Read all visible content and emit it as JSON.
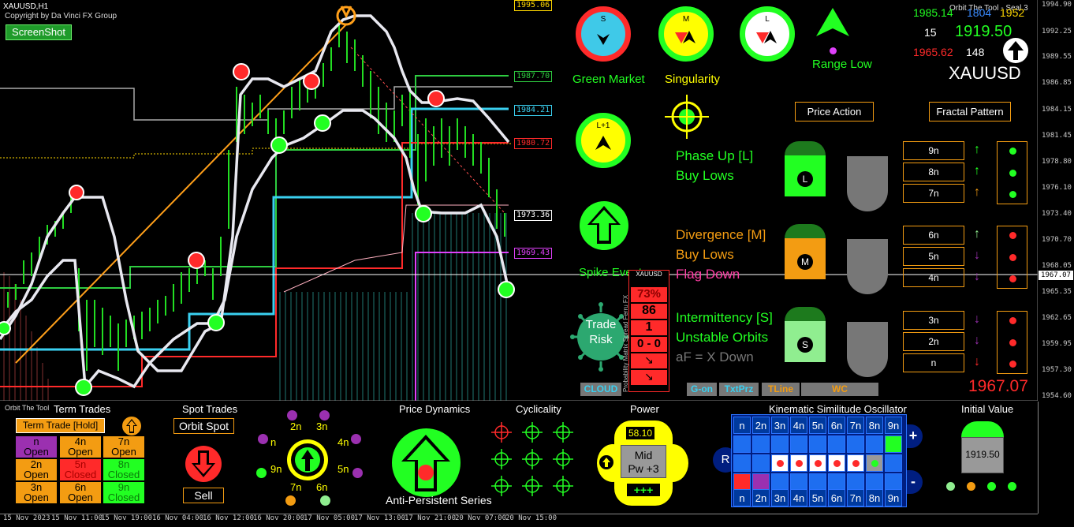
{
  "window": {
    "symbol_tf": "XAUUSD,H1",
    "copyright": "Copyright by Da Vinci FX Group",
    "orbit_tool_label": "Orbit The Tool - Seal 3"
  },
  "screenshot_button": "ScreenShot",
  "price_levels": [
    {
      "label": "1995.06",
      "color": "#ffd700"
    },
    {
      "label": "1987.70",
      "color": "#2ecc40"
    },
    {
      "label": "1984.21",
      "color": "#3ad0f0"
    },
    {
      "label": "1980.72",
      "color": "#ff2a2a"
    },
    {
      "label": "1973.36",
      "color": "#ffffff"
    },
    {
      "label": "1969.43",
      "color": "#e040fb"
    }
  ],
  "y_axis": [
    "1994.90",
    "1992.25",
    "1989.55",
    "1986.85",
    "1984.15",
    "1981.45",
    "1978.80",
    "1976.10",
    "1973.40",
    "1970.70",
    "1968.05",
    "1965.35",
    "1962.65",
    "1959.95",
    "1957.30",
    "1954.60"
  ],
  "current_price_tag": "1967.07",
  "x_axis": [
    "15 Nov 2023",
    "15 Nov 11:00",
    "15 Nov 19:00",
    "16 Nov 04:00",
    "16 Nov 12:00",
    "16 Nov 20:00",
    "17 Nov 05:00",
    "17 Nov 13:00",
    "17 Nov 21:00",
    "20 Nov 07:00",
    "20 Nov 15:00"
  ],
  "top_dials": [
    {
      "letter": "S",
      "ring": "#ff2a2a",
      "fill": "#3fc9e8",
      "caption": "Green Market",
      "caption_color": "#22ff22"
    },
    {
      "letter": "M",
      "ring": "#22ff22",
      "fill": "#ffff00",
      "caption": "Singularity",
      "caption_color": "#ffff00"
    },
    {
      "letter": "L",
      "ring": "#22ff22",
      "fill": "#ffffff",
      "caption": "",
      "caption_color": "#fff"
    }
  ],
  "range_low": "Range Low",
  "stats": {
    "v1": "1985.14",
    "v2": "1804",
    "v3": "1952",
    "count1": "15",
    "price": "1919.50",
    "low": "1965.62",
    "count2": "148",
    "symbol": "XAUUSD"
  },
  "buttons": {
    "price_action": "Price Action",
    "fractal_pattern": "Fractal Pattern"
  },
  "lplus_dial": "L+1",
  "spike_event": "Spike Event",
  "phases": [
    {
      "line1": "Phase Up [L]",
      "line2": "Buy Lows",
      "color1": "#22ff22",
      "color2": "#22ff22",
      "badge": "L",
      "badge_color": "#22ff22"
    },
    {
      "line1": "Divergence [M]",
      "line2": "Buy Lows",
      "line3": "Flag Down",
      "color1": "#f39c12",
      "color2": "#f39c12",
      "badge": "M",
      "badge_color": "#f39c12"
    },
    {
      "line1": "Intermittency [S]",
      "line2": "Unstable Orbits",
      "line3": "aF = X Down",
      "color1": "#22ff22",
      "color2": "#22ff22",
      "badge": "S",
      "badge_color": "#90ee90"
    }
  ],
  "n_rows": [
    {
      "label": "9n",
      "arrow": "up",
      "color": "#22ff22",
      "dot": "#22ff22"
    },
    {
      "label": "8n",
      "arrow": "up",
      "color": "#22ff22",
      "dot": "#22ff22"
    },
    {
      "label": "7n",
      "arrow": "up",
      "color": "#f39c12",
      "dot": "#22ff22"
    },
    {
      "label": "6n",
      "arrow": "up",
      "color": "#90ee90",
      "dot": "#ff2a2a"
    },
    {
      "label": "5n",
      "arrow": "down",
      "color": "#9b30b0",
      "dot": "#ff2a2a"
    },
    {
      "label": "4n",
      "arrow": "down",
      "color": "#9b30b0",
      "dot": "#ff2a2a"
    },
    {
      "label": "3n",
      "arrow": "down",
      "color": "#9b30b0",
      "dot": "#ff2a2a"
    },
    {
      "label": "2n",
      "arrow": "down",
      "color": "#9b30b0",
      "dot": "#ff2a2a"
    },
    {
      "label": "n",
      "arrow": "down",
      "color": "#ff2a2a",
      "dot": "#ff2a2a"
    }
  ],
  "trade_risk": "Trade Risk",
  "risk_column": {
    "header": "XAUUSD",
    "pct": "73%",
    "v1": "86",
    "v2": "1",
    "v3": "0 - 0",
    "side_text": "Probability Matrix Spread Ferru FX"
  },
  "bottom_tags": [
    "CLOUD",
    "G-on",
    "TxtPrz",
    "TLine",
    "WC"
  ],
  "big_price": "1967.07",
  "term_trades": {
    "title": "Term Trades",
    "orbit_label": "Orbit The Tool",
    "hold_button": "Term Trade [Hold]",
    "cells": [
      {
        "text": "n\nOpen",
        "bg": "#9b30b0",
        "color": "#000"
      },
      {
        "text": "4n\nOpen",
        "bg": "#f39c12",
        "color": "#000"
      },
      {
        "text": "7n\nOpen",
        "bg": "#f39c12",
        "color": "#000"
      },
      {
        "text": "2n\nOpen",
        "bg": "#f39c12",
        "color": "#000"
      },
      {
        "text": "5n\nClosed",
        "bg": "#ff2a2a",
        "color": "#c00"
      },
      {
        "text": "8n\nClosed",
        "bg": "#22ff22",
        "color": "#0a7a0a"
      },
      {
        "text": "3n\nOpen",
        "bg": "#f39c12",
        "color": "#000"
      },
      {
        "text": "6n\nOpen",
        "bg": "#f39c12",
        "color": "#000"
      },
      {
        "text": "9n\nClosed",
        "bg": "#22ff22",
        "color": "#0a7a0a"
      }
    ]
  },
  "spot_trades": {
    "title": "Spot Trades",
    "orbit_spot": "Orbit Spot",
    "sell": "Sell"
  },
  "orbit_labels": [
    "2n",
    "3n",
    "n",
    "4n",
    "9n",
    "5n",
    "7n",
    "6n"
  ],
  "price_dynamics": {
    "title": "Price Dynamics",
    "caption": "Anti-Persistent Series"
  },
  "cyclicality": {
    "title": "Cyclicality"
  },
  "power": {
    "title": "Power",
    "value": "58.10",
    "mid": "Mid",
    "pw": "Pw +3",
    "plus": "+++"
  },
  "kso": {
    "title": "Kinematic Similitude Oscillator",
    "labels": [
      "n",
      "2n",
      "3n",
      "4n",
      "5n",
      "6n",
      "7n",
      "8n",
      "9n"
    ],
    "r": "R",
    "plus": "+",
    "minus": "-"
  },
  "initial_value": {
    "title": "Initial Value",
    "value": "1919.50"
  }
}
